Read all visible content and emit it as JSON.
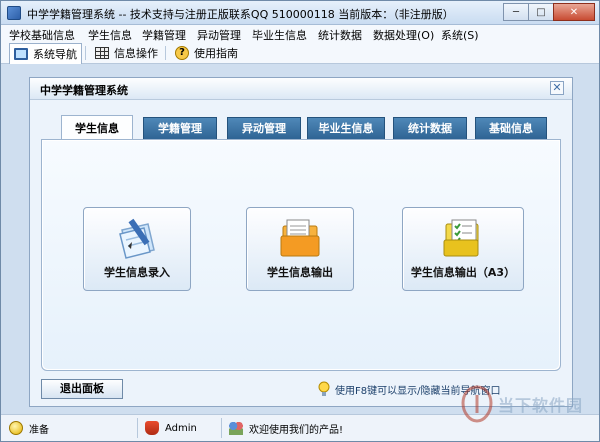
{
  "window": {
    "title": "中学学籍管理系统 -- 技术支持与注册正版联系QQ 510000118    当前版本：（非注册版）",
    "min_glyph": "─",
    "max_glyph": "□",
    "close_glyph": "✕"
  },
  "menu": [
    "学校基础信息",
    "学生信息",
    "学籍管理",
    "异动管理",
    "毕业生信息",
    "统计数据",
    "数据处理(O)",
    "系统(S)"
  ],
  "toolbar": {
    "items": [
      {
        "label": "系统导航"
      },
      {
        "label": "信息操作"
      },
      {
        "label": "使用指南"
      }
    ],
    "help_glyph": "?"
  },
  "panel": {
    "title": "中学学籍管理系统",
    "close_glyph": "✕"
  },
  "tabs": [
    "学生信息",
    "学籍管理",
    "异动管理",
    "毕业生信息",
    "统计数据",
    "基础信息"
  ],
  "active_tab_index": 0,
  "feature_buttons": [
    {
      "label": "学生信息录入",
      "icon": "pen-paper-icon"
    },
    {
      "label": "学生信息输出",
      "icon": "folder-document-icon"
    },
    {
      "label": "学生信息输出（A3）",
      "icon": "checklist-folder-icon"
    }
  ],
  "exit_button": "退出面板",
  "hint": "使用F8键可以显示/隐藏当前导航窗口",
  "status": {
    "ready": "准备",
    "user": "Admin",
    "welcome": "欢迎使用我们的产品!"
  },
  "watermark": {
    "text": "当下软件园"
  },
  "colors": {
    "tab_active_bg": "#fdfeff",
    "tab_bg": "#2f6494",
    "accent": "#3f6ea6"
  }
}
